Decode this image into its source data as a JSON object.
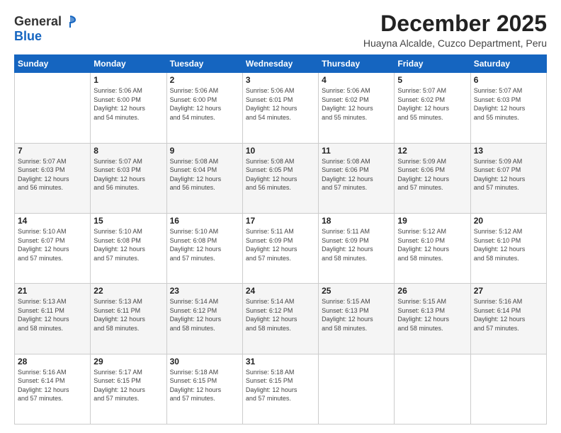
{
  "logo": {
    "general": "General",
    "blue": "Blue"
  },
  "header": {
    "title": "December 2025",
    "subtitle": "Huayna Alcalde, Cuzco Department, Peru"
  },
  "weekdays": [
    "Sunday",
    "Monday",
    "Tuesday",
    "Wednesday",
    "Thursday",
    "Friday",
    "Saturday"
  ],
  "weeks": [
    [
      {
        "day": "",
        "info": ""
      },
      {
        "day": "1",
        "info": "Sunrise: 5:06 AM\nSunset: 6:00 PM\nDaylight: 12 hours\nand 54 minutes."
      },
      {
        "day": "2",
        "info": "Sunrise: 5:06 AM\nSunset: 6:00 PM\nDaylight: 12 hours\nand 54 minutes."
      },
      {
        "day": "3",
        "info": "Sunrise: 5:06 AM\nSunset: 6:01 PM\nDaylight: 12 hours\nand 54 minutes."
      },
      {
        "day": "4",
        "info": "Sunrise: 5:06 AM\nSunset: 6:02 PM\nDaylight: 12 hours\nand 55 minutes."
      },
      {
        "day": "5",
        "info": "Sunrise: 5:07 AM\nSunset: 6:02 PM\nDaylight: 12 hours\nand 55 minutes."
      },
      {
        "day": "6",
        "info": "Sunrise: 5:07 AM\nSunset: 6:03 PM\nDaylight: 12 hours\nand 55 minutes."
      }
    ],
    [
      {
        "day": "7",
        "info": "Sunrise: 5:07 AM\nSunset: 6:03 PM\nDaylight: 12 hours\nand 56 minutes."
      },
      {
        "day": "8",
        "info": "Sunrise: 5:07 AM\nSunset: 6:03 PM\nDaylight: 12 hours\nand 56 minutes."
      },
      {
        "day": "9",
        "info": "Sunrise: 5:08 AM\nSunset: 6:04 PM\nDaylight: 12 hours\nand 56 minutes."
      },
      {
        "day": "10",
        "info": "Sunrise: 5:08 AM\nSunset: 6:05 PM\nDaylight: 12 hours\nand 56 minutes."
      },
      {
        "day": "11",
        "info": "Sunrise: 5:08 AM\nSunset: 6:06 PM\nDaylight: 12 hours\nand 57 minutes."
      },
      {
        "day": "12",
        "info": "Sunrise: 5:09 AM\nSunset: 6:06 PM\nDaylight: 12 hours\nand 57 minutes."
      },
      {
        "day": "13",
        "info": "Sunrise: 5:09 AM\nSunset: 6:07 PM\nDaylight: 12 hours\nand 57 minutes."
      }
    ],
    [
      {
        "day": "14",
        "info": "Sunrise: 5:10 AM\nSunset: 6:07 PM\nDaylight: 12 hours\nand 57 minutes."
      },
      {
        "day": "15",
        "info": "Sunrise: 5:10 AM\nSunset: 6:08 PM\nDaylight: 12 hours\nand 57 minutes."
      },
      {
        "day": "16",
        "info": "Sunrise: 5:10 AM\nSunset: 6:08 PM\nDaylight: 12 hours\nand 57 minutes."
      },
      {
        "day": "17",
        "info": "Sunrise: 5:11 AM\nSunset: 6:09 PM\nDaylight: 12 hours\nand 57 minutes."
      },
      {
        "day": "18",
        "info": "Sunrise: 5:11 AM\nSunset: 6:09 PM\nDaylight: 12 hours\nand 58 minutes."
      },
      {
        "day": "19",
        "info": "Sunrise: 5:12 AM\nSunset: 6:10 PM\nDaylight: 12 hours\nand 58 minutes."
      },
      {
        "day": "20",
        "info": "Sunrise: 5:12 AM\nSunset: 6:10 PM\nDaylight: 12 hours\nand 58 minutes."
      }
    ],
    [
      {
        "day": "21",
        "info": "Sunrise: 5:13 AM\nSunset: 6:11 PM\nDaylight: 12 hours\nand 58 minutes."
      },
      {
        "day": "22",
        "info": "Sunrise: 5:13 AM\nSunset: 6:11 PM\nDaylight: 12 hours\nand 58 minutes."
      },
      {
        "day": "23",
        "info": "Sunrise: 5:14 AM\nSunset: 6:12 PM\nDaylight: 12 hours\nand 58 minutes."
      },
      {
        "day": "24",
        "info": "Sunrise: 5:14 AM\nSunset: 6:12 PM\nDaylight: 12 hours\nand 58 minutes."
      },
      {
        "day": "25",
        "info": "Sunrise: 5:15 AM\nSunset: 6:13 PM\nDaylight: 12 hours\nand 58 minutes."
      },
      {
        "day": "26",
        "info": "Sunrise: 5:15 AM\nSunset: 6:13 PM\nDaylight: 12 hours\nand 58 minutes."
      },
      {
        "day": "27",
        "info": "Sunrise: 5:16 AM\nSunset: 6:14 PM\nDaylight: 12 hours\nand 57 minutes."
      }
    ],
    [
      {
        "day": "28",
        "info": "Sunrise: 5:16 AM\nSunset: 6:14 PM\nDaylight: 12 hours\nand 57 minutes."
      },
      {
        "day": "29",
        "info": "Sunrise: 5:17 AM\nSunset: 6:15 PM\nDaylight: 12 hours\nand 57 minutes."
      },
      {
        "day": "30",
        "info": "Sunrise: 5:18 AM\nSunset: 6:15 PM\nDaylight: 12 hours\nand 57 minutes."
      },
      {
        "day": "31",
        "info": "Sunrise: 5:18 AM\nSunset: 6:15 PM\nDaylight: 12 hours\nand 57 minutes."
      },
      {
        "day": "",
        "info": ""
      },
      {
        "day": "",
        "info": ""
      },
      {
        "day": "",
        "info": ""
      }
    ]
  ]
}
